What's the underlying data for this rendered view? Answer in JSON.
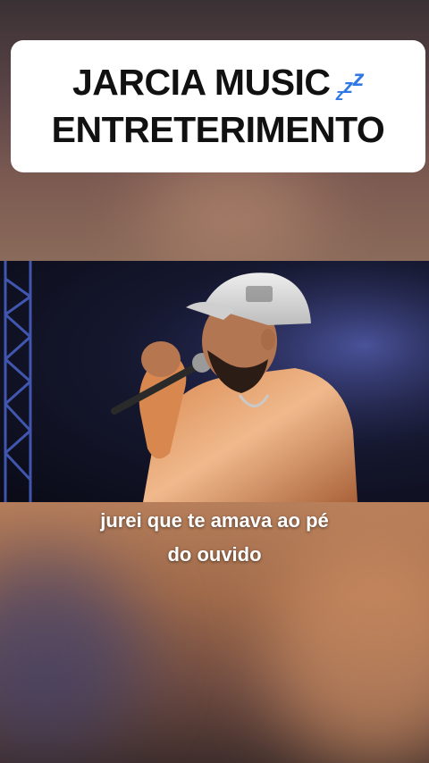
{
  "header": {
    "title_line1": "JARCIA MUSIC",
    "title_line2": "ENTRETERIMENTO",
    "title_emoji": "zzz-icon",
    "zzz": [
      "z",
      "z",
      "z"
    ]
  },
  "video": {
    "description_icon": "singer-with-microphone"
  },
  "caption": {
    "line1": "jurei que te amava ao pé",
    "line2": "do ouvido"
  },
  "colors": {
    "card_background": "#ffffff",
    "title_text": "#111111",
    "zzz_blue": "#2f78e6",
    "caption_text": "#ffffff"
  }
}
